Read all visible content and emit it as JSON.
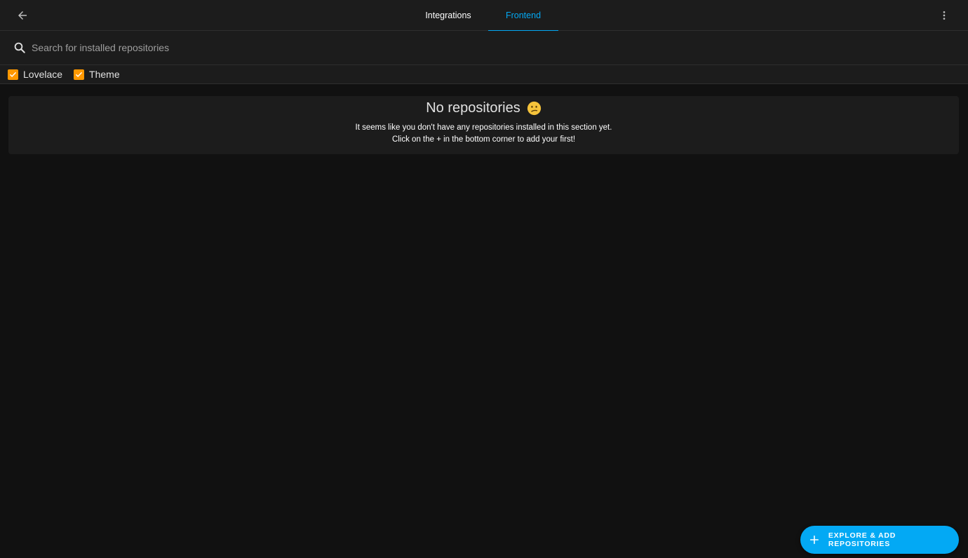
{
  "colors": {
    "accent": "#03a9f4",
    "checkbox": "#ff9800",
    "background": "#111111",
    "surface": "#1c1c1c"
  },
  "header": {
    "back_icon": "arrow-left-icon",
    "tabs": [
      {
        "label": "Integrations",
        "active": false
      },
      {
        "label": "Frontend",
        "active": true
      }
    ],
    "menu_icon": "dots-vertical-icon"
  },
  "search": {
    "icon": "search-icon",
    "placeholder": "Search for installed repositories",
    "value": ""
  },
  "filters": [
    {
      "label": "Lovelace",
      "checked": true
    },
    {
      "label": "Theme",
      "checked": true
    }
  ],
  "empty_state": {
    "title": "No repositories",
    "emoji": "confused-face-icon",
    "line1": "It seems like you don't have any repositories installed in this section yet.",
    "line2": "Click on the + in the bottom corner to add your first!"
  },
  "fab": {
    "icon": "plus-icon",
    "label": "EXPLORE & ADD REPOSITORIES"
  }
}
